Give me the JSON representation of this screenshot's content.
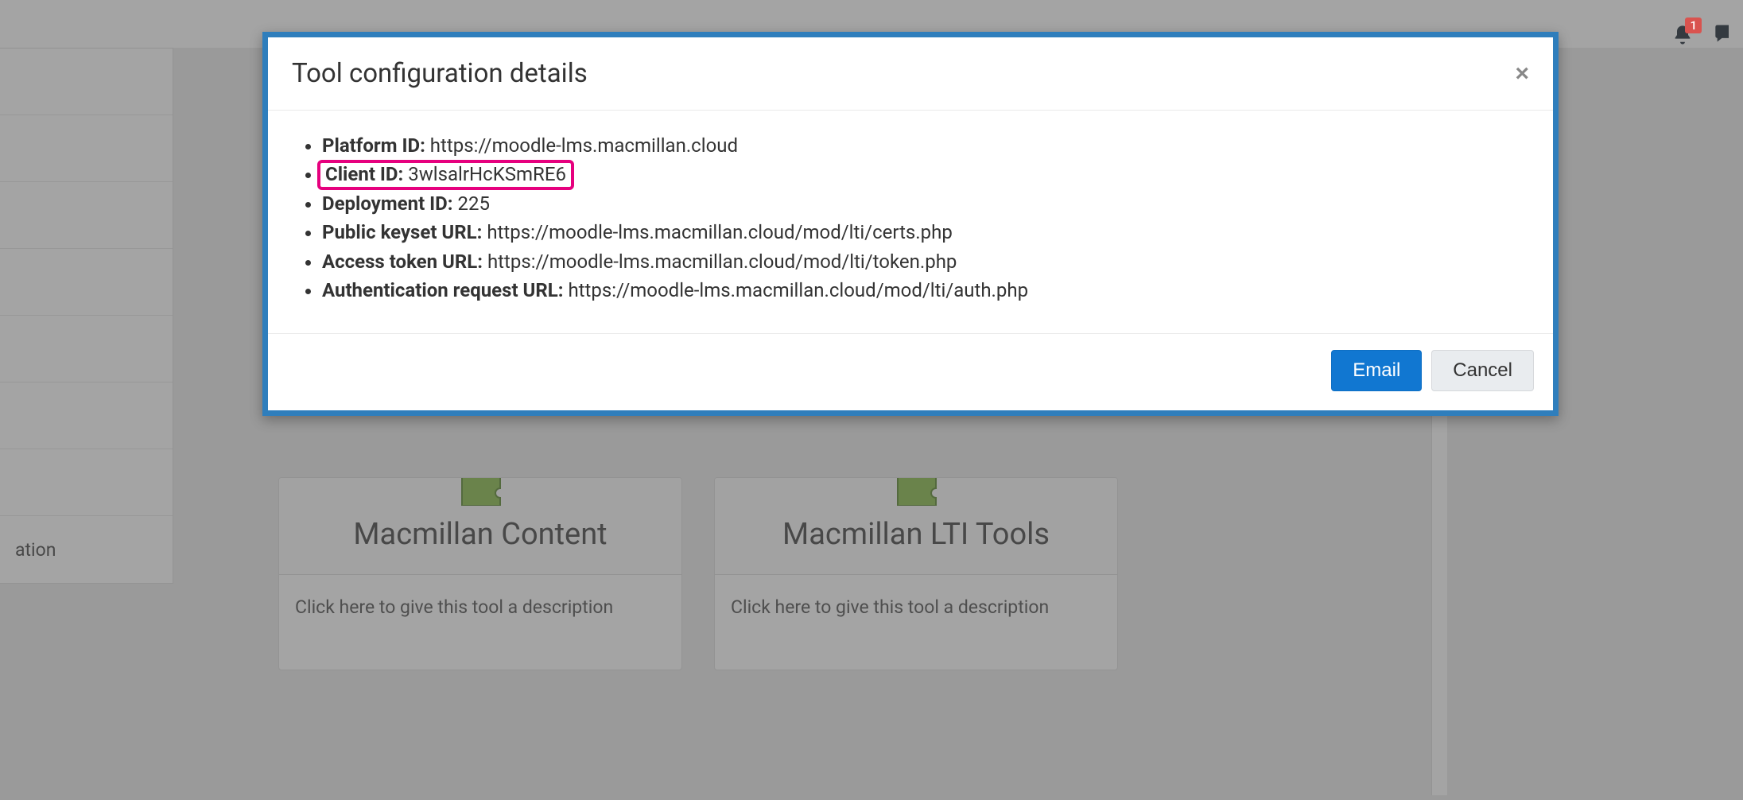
{
  "top": {
    "notification_count": "1"
  },
  "sidebar": {
    "visible_label": "ation"
  },
  "cards": [
    {
      "title": "Macmillan Content",
      "body": "Click here to give this tool a description"
    },
    {
      "title": "Macmillan LTI Tools",
      "body": "Click here to give this tool a description"
    }
  ],
  "modal": {
    "title": "Tool configuration details",
    "close_glyph": "×",
    "details": [
      {
        "label": "Platform ID:",
        "value": "https://moodle-lms.macmillan.cloud",
        "highlighted": false
      },
      {
        "label": "Client ID:",
        "value": "3wlsalrHcKSmRE6",
        "highlighted": true
      },
      {
        "label": "Deployment ID:",
        "value": "225",
        "highlighted": false
      },
      {
        "label": "Public keyset URL:",
        "value": "https://moodle-lms.macmillan.cloud/mod/lti/certs.php",
        "highlighted": false
      },
      {
        "label": "Access token URL:",
        "value": "https://moodle-lms.macmillan.cloud/mod/lti/token.php",
        "highlighted": false
      },
      {
        "label": "Authentication request URL:",
        "value": "https://moodle-lms.macmillan.cloud/mod/lti/auth.php",
        "highlighted": false
      }
    ],
    "buttons": {
      "primary": "Email",
      "secondary": "Cancel"
    }
  }
}
